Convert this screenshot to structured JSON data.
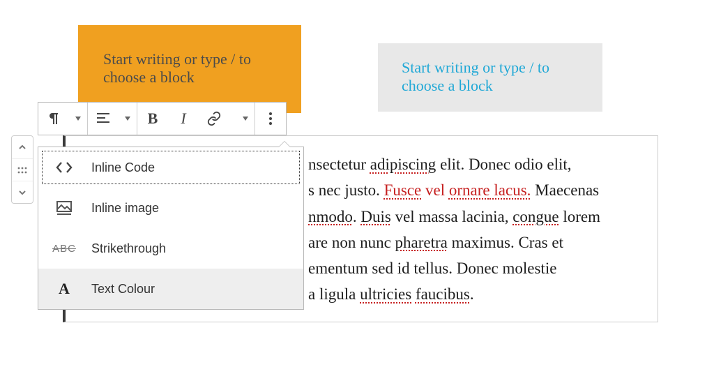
{
  "placeholders": {
    "orange": "Start writing or type / to choose a block",
    "grey": "Start writing or type / to choose a block"
  },
  "toolbar": {
    "para_icon": "paragraph",
    "align_icon": "align-left",
    "bold": "B",
    "italic": "I",
    "link_icon": "link",
    "more_icon": "more"
  },
  "dropdown": {
    "items": [
      {
        "icon": "code-icon",
        "label": "Inline Code",
        "state": "focused"
      },
      {
        "icon": "image-icon",
        "label": "Inline image",
        "state": ""
      },
      {
        "icon": "strike-icon",
        "label": "Strikethrough",
        "state": ""
      },
      {
        "icon": "text-color-icon",
        "label": "Text Colour",
        "state": "highlight"
      }
    ]
  },
  "paragraph": {
    "t01": "nsectetur ",
    "t02": "adipiscing",
    "t03": " elit. Donec odio elit,",
    "t04": "s nec justo. ",
    "t05": "Fusce",
    "t06": " vel ",
    "t07": "ornare",
    "t08": " lacus.",
    "t09": " Maecenas",
    "t10": "nmodo",
    "t11": ". ",
    "t12": "Duis",
    "t13": " vel massa lacinia, ",
    "t14": "congue",
    "t15": " lorem",
    "t16": "are non nunc ",
    "t17": "pharetra",
    "t18": " maximus. Cras et",
    "t19": "ementum sed id tellus. Donec molestie",
    "t20": "a ligula ",
    "t21": "ultricies",
    "t22": " ",
    "t23": "faucibus",
    "t24": "."
  }
}
